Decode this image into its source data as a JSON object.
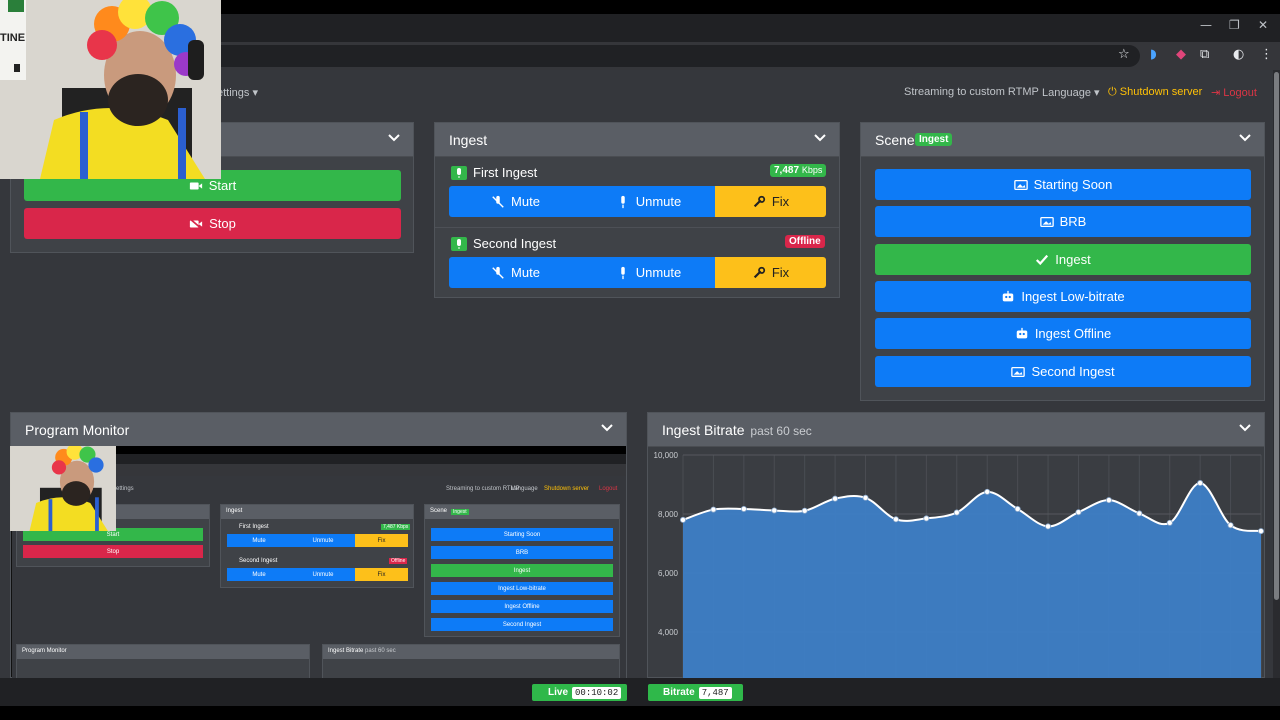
{
  "browser": {
    "window_controls": [
      "—",
      "❐",
      "✕"
    ],
    "toolbar_icons": [
      "star-icon",
      "extension-icon",
      "profile-icon",
      "more-icon"
    ]
  },
  "navbar": {
    "settings_label": "ettings",
    "streaming_to": "Streaming to custom RTMP",
    "language": "Language",
    "shutdown": "Shutdown server",
    "logout": "Logout"
  },
  "stream_card": {
    "start_label": "Start",
    "stop_label": "Stop"
  },
  "ingest_card": {
    "title": "Ingest",
    "ingests": [
      {
        "name": "First Ingest",
        "status_value": "7,487",
        "status_unit": "Kbps",
        "status_type": "online",
        "mute": "Mute",
        "unmute": "Unmute",
        "fix": "Fix"
      },
      {
        "name": "Second Ingest",
        "status_value": "Offline",
        "status_unit": "",
        "status_type": "offline",
        "mute": "Mute",
        "unmute": "Unmute",
        "fix": "Fix"
      }
    ]
  },
  "scene_card": {
    "title": "Scene",
    "current_badge": "Ingest",
    "scenes": [
      {
        "label": "Starting Soon",
        "icon": "image-icon",
        "active": false
      },
      {
        "label": "BRB",
        "icon": "image-icon",
        "active": false
      },
      {
        "label": "Ingest",
        "icon": "check-icon",
        "active": true
      },
      {
        "label": "Ingest Low-bitrate",
        "icon": "robot-icon",
        "active": false
      },
      {
        "label": "Ingest Offline",
        "icon": "robot-icon",
        "active": false
      },
      {
        "label": "Second Ingest",
        "icon": "image-icon",
        "active": false
      }
    ]
  },
  "program_monitor": {
    "title": "Program Monitor"
  },
  "bitrate_card": {
    "title": "Ingest Bitrate",
    "subtitle": "past 60 sec"
  },
  "chart_data": {
    "type": "area",
    "title": "Ingest Bitrate",
    "subtitle": "past 60 sec",
    "y_ticks": [
      "10,000",
      "8,000",
      "6,000",
      "4,000"
    ],
    "ylim": [
      3000,
      10000
    ],
    "grid": true,
    "color": "#3d7ec6",
    "values": [
      7800,
      8150,
      8170,
      8120,
      8110,
      8520,
      8550,
      7820,
      7850,
      8050,
      8750,
      8170,
      7580,
      8060,
      8470,
      8020,
      7700,
      9050,
      7620,
      7420
    ]
  },
  "statusbar": {
    "live_label": "Live",
    "live_time": "00:10:02",
    "bitrate_label": "Bitrate",
    "bitrate_value": "7,487"
  },
  "mini_monitor": {
    "settings": "ettings",
    "streaming_to": "Streaming to custom RTMP",
    "language": "Language",
    "shutdown": "Shutdown server",
    "logout": "Logout",
    "start": "Start",
    "stop": "Stop",
    "ingest_title": "Ingest",
    "first_ingest": "First Ingest",
    "first_status": "7,487 Kbps",
    "second_ingest": "Second Ingest",
    "second_status": "Offline",
    "mute": "Mute",
    "unmute": "Unmute",
    "fix": "Fix",
    "scene_title": "Scene",
    "scene_badge": "Ingest",
    "scenes": [
      "Starting Soon",
      "BRB",
      "Ingest",
      "Ingest Low-bitrate",
      "Ingest Offline",
      "Second Ingest"
    ],
    "program_monitor": "Program Monitor",
    "bitrate_title": "Ingest Bitrate",
    "bitrate_sub": "past 60 sec"
  },
  "webcam_sign": "TINE",
  "colors": {
    "green": "#33b74a",
    "red": "#d9264a",
    "blue": "#0d7bf7",
    "yellow": "#fdc01a",
    "warning": "#ffc107"
  }
}
